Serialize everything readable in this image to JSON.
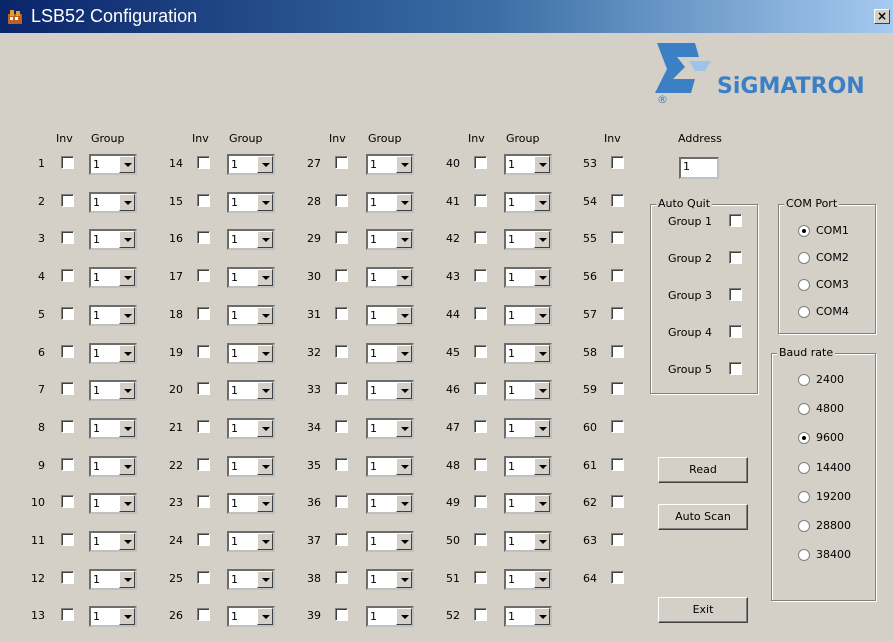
{
  "window": {
    "title": "LSB52 Configuration",
    "close_label": "×"
  },
  "headers": {
    "inv": "Inv",
    "group": "Group",
    "address": "Address"
  },
  "channels": [
    {
      "num": "1",
      "group": "1"
    },
    {
      "num": "2",
      "group": "1"
    },
    {
      "num": "3",
      "group": "1"
    },
    {
      "num": "4",
      "group": "1"
    },
    {
      "num": "5",
      "group": "1"
    },
    {
      "num": "6",
      "group": "1"
    },
    {
      "num": "7",
      "group": "1"
    },
    {
      "num": "8",
      "group": "1"
    },
    {
      "num": "9",
      "group": "1"
    },
    {
      "num": "10",
      "group": "1"
    },
    {
      "num": "11",
      "group": "1"
    },
    {
      "num": "12",
      "group": "1"
    },
    {
      "num": "13",
      "group": "1"
    },
    {
      "num": "14",
      "group": "1"
    },
    {
      "num": "15",
      "group": "1"
    },
    {
      "num": "16",
      "group": "1"
    },
    {
      "num": "17",
      "group": "1"
    },
    {
      "num": "18",
      "group": "1"
    },
    {
      "num": "19",
      "group": "1"
    },
    {
      "num": "20",
      "group": "1"
    },
    {
      "num": "21",
      "group": "1"
    },
    {
      "num": "22",
      "group": "1"
    },
    {
      "num": "23",
      "group": "1"
    },
    {
      "num": "24",
      "group": "1"
    },
    {
      "num": "25",
      "group": "1"
    },
    {
      "num": "26",
      "group": "1"
    },
    {
      "num": "27",
      "group": "1"
    },
    {
      "num": "28",
      "group": "1"
    },
    {
      "num": "29",
      "group": "1"
    },
    {
      "num": "30",
      "group": "1"
    },
    {
      "num": "31",
      "group": "1"
    },
    {
      "num": "32",
      "group": "1"
    },
    {
      "num": "33",
      "group": "1"
    },
    {
      "num": "34",
      "group": "1"
    },
    {
      "num": "35",
      "group": "1"
    },
    {
      "num": "36",
      "group": "1"
    },
    {
      "num": "37",
      "group": "1"
    },
    {
      "num": "38",
      "group": "1"
    },
    {
      "num": "39",
      "group": "1"
    },
    {
      "num": "40",
      "group": "1"
    },
    {
      "num": "41",
      "group": "1"
    },
    {
      "num": "42",
      "group": "1"
    },
    {
      "num": "43",
      "group": "1"
    },
    {
      "num": "44",
      "group": "1"
    },
    {
      "num": "45",
      "group": "1"
    },
    {
      "num": "46",
      "group": "1"
    },
    {
      "num": "47",
      "group": "1"
    },
    {
      "num": "48",
      "group": "1"
    },
    {
      "num": "49",
      "group": "1"
    },
    {
      "num": "50",
      "group": "1"
    },
    {
      "num": "51",
      "group": "1"
    },
    {
      "num": "52",
      "group": "1"
    },
    {
      "num": "53"
    },
    {
      "num": "54"
    },
    {
      "num": "55"
    },
    {
      "num": "56"
    },
    {
      "num": "57"
    },
    {
      "num": "58"
    },
    {
      "num": "59"
    },
    {
      "num": "60"
    },
    {
      "num": "61"
    },
    {
      "num": "62"
    },
    {
      "num": "63"
    },
    {
      "num": "64"
    }
  ],
  "address": {
    "value": "1"
  },
  "auto_quit": {
    "title": "Auto Quit",
    "groups": [
      "Group 1",
      "Group 2",
      "Group 3",
      "Group 4",
      "Group 5"
    ]
  },
  "com_port": {
    "title": "COM Port",
    "options": [
      "COM1",
      "COM2",
      "COM3",
      "COM4"
    ],
    "selected": "COM1"
  },
  "baud_rate": {
    "title": "Baud rate",
    "options": [
      "2400",
      "4800",
      "9600",
      "14400",
      "19200",
      "28800",
      "38400"
    ],
    "selected": "9600"
  },
  "buttons": {
    "read": "Read",
    "auto_scan": "Auto Scan",
    "exit": "Exit"
  },
  "logo": {
    "text": "SiGMATRON",
    "registered": "®",
    "color": "#3b7fc4"
  }
}
